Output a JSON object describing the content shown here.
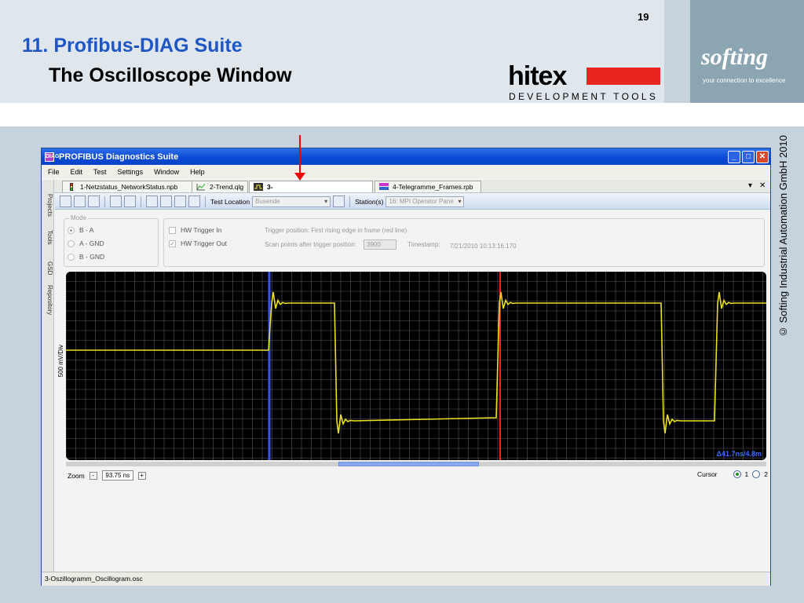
{
  "slide": {
    "number": "19",
    "title": "11. Profibus-DIAG Suite",
    "subtitle": "The Oscilloscope Window",
    "hitex_logo": "hitex",
    "hitex_tagline": "DEVELOPMENT TOOLS",
    "softing_logo": "softing",
    "softing_tagline": "your connection to excellence",
    "copyright": "© Softing Industrial Automation GmbH  2010"
  },
  "app": {
    "title": "PROFIBUS Diagnostics Suite",
    "icon_label": "DIAG",
    "menu": [
      "File",
      "Edit",
      "Test",
      "Settings",
      "Window",
      "Help"
    ],
    "tabs": [
      {
        "label": "1-Netzstatus_NetworkStatus.npb",
        "icon": "traffic-light-icon",
        "active": false
      },
      {
        "label": "2-Trend.qlg",
        "icon": "trend-chart-icon",
        "active": false
      },
      {
        "label": "3-Oszillogramm_Oscillogram.osc",
        "icon": "oscilloscope-icon",
        "active": true
      },
      {
        "label": "4-Telegramme_Frames.rpb",
        "icon": "frames-icon",
        "active": false
      }
    ],
    "tab_controls": {
      "dropdown": "▾",
      "close": "✕"
    },
    "sidebar": [
      "Projects",
      "Tools",
      "GSD",
      "Repository"
    ],
    "toolbar": {
      "test_location_label": "Test Location",
      "test_location_value": "Busende",
      "station_label": "Station(s)",
      "station_value": "16: MPI Operator Pane"
    },
    "mode": {
      "legend": "Mode",
      "options": [
        {
          "label": "B - A",
          "selected": true
        },
        {
          "label": "A - GND",
          "selected": false
        },
        {
          "label": "B - GND",
          "selected": false
        }
      ]
    },
    "trigger": {
      "hw_in_label": "HW Trigger In",
      "hw_in_checked": false,
      "hw_out_label": "HW Trigger Out",
      "hw_out_checked": true,
      "position_text": "Trigger position: First rising edge in frame (red line)",
      "scan_label": "Scan points after trigger position:",
      "scan_value": "3900",
      "timestamp_label": "Timestamp:",
      "timestamp_value": "7/21/2010 10:13:16.170"
    },
    "scope": {
      "y_label": "500 mV/Div",
      "delta_text": "Δ41.7ns/4.8m",
      "trace_color": "#e8e020",
      "cursor1_color": "#3355ff",
      "cursor2_color": "#ff2020",
      "grid_color": "#5a5a5a"
    },
    "zoom": {
      "label": "Zoom",
      "minus": "-",
      "value": "93.75 ns",
      "plus": "+"
    },
    "cursor": {
      "label": "Cursor",
      "options": [
        "1",
        "2"
      ],
      "selected": "1"
    },
    "status": "3-Oszillogramm_Oscillogram.osc"
  }
}
